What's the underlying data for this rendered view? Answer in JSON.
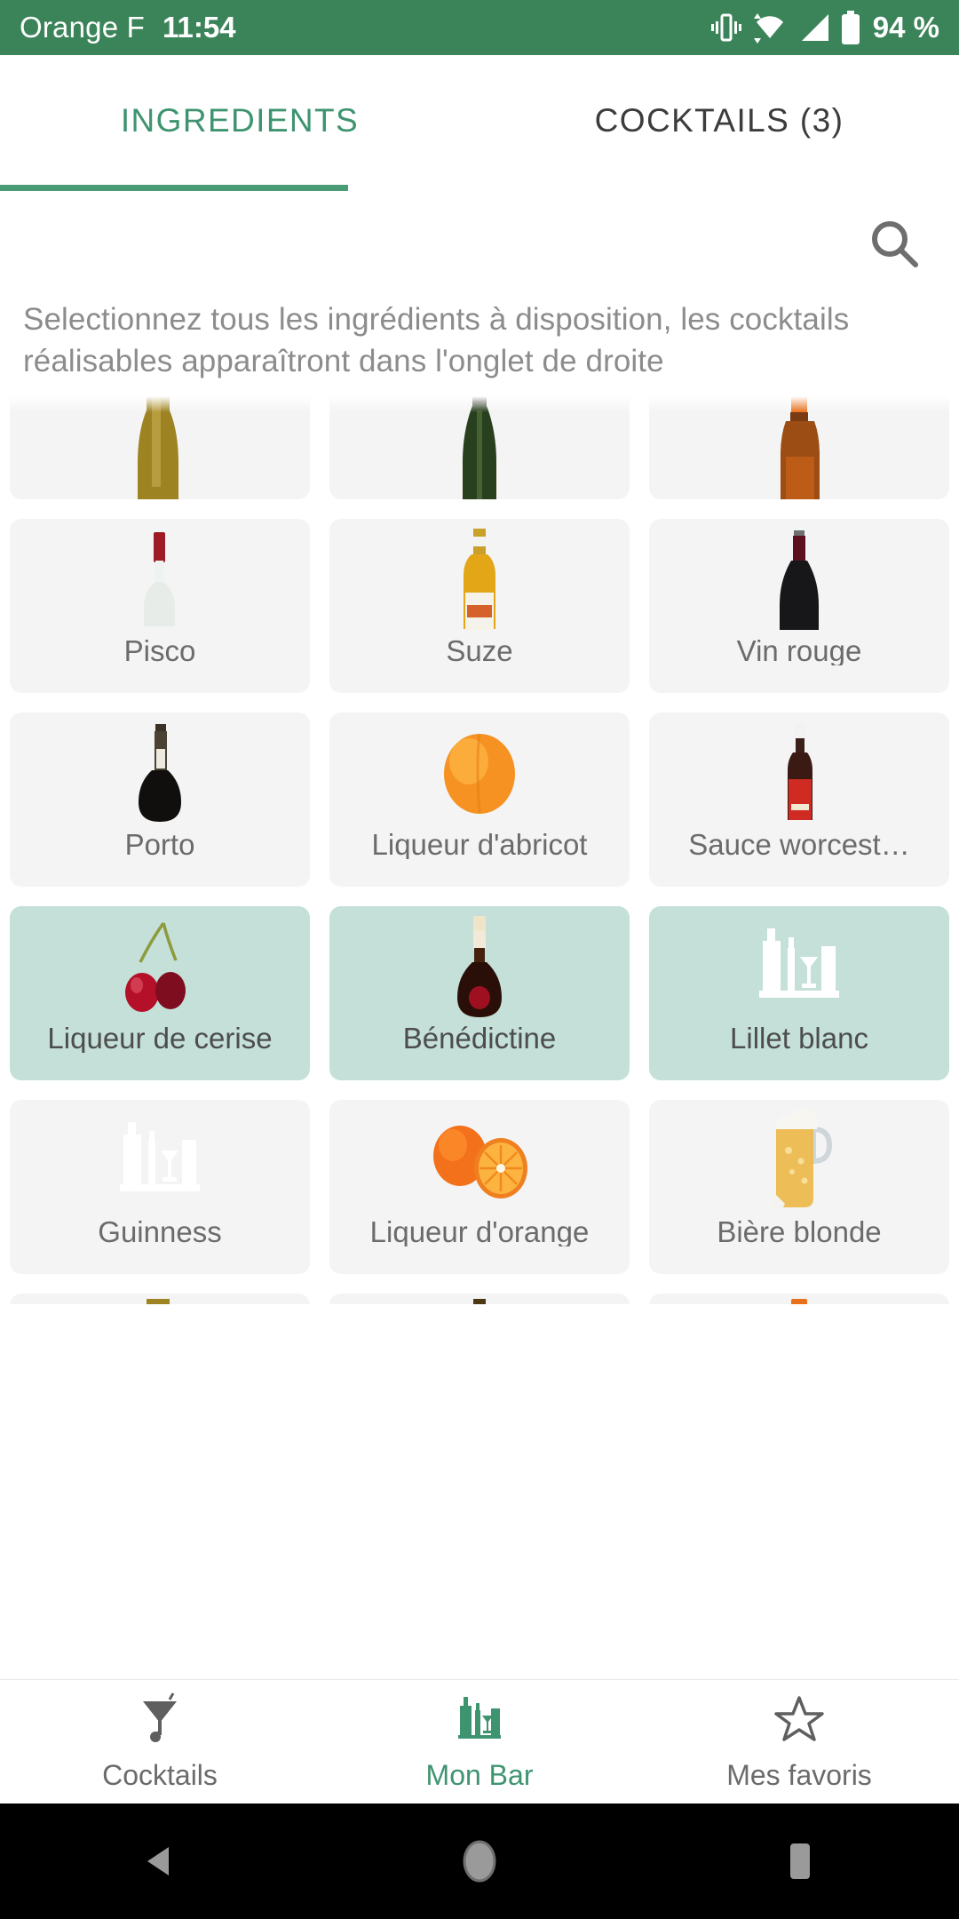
{
  "statusbar": {
    "carrier": "Orange F",
    "time": "11:54",
    "battery": "94 %",
    "icons": [
      "vibrate-icon",
      "wifi-icon",
      "signal-icon",
      "battery-icon"
    ],
    "background_color": "#3b8459"
  },
  "tabs": {
    "ingredients_label": "INGREDIENTS",
    "cocktails_label": "COCKTAILS (3)",
    "active": "INGREDIENTS",
    "accent_color": "#3f9470"
  },
  "search": {
    "icon": "search-icon"
  },
  "description": "Selectionnez tous les ingrédients à disposition, les cocktails réalisables apparaîtront dans l'onglet de droite",
  "grid": {
    "selected_color": "#c4e0d8",
    "card_color": "#f4f4f4",
    "items": [
      {
        "label": "",
        "image": "bottle-gold-partial",
        "selected": false,
        "partial_top": true
      },
      {
        "label": "",
        "image": "bottle-yellow-partial",
        "selected": false,
        "partial_top": true
      },
      {
        "label": "",
        "image": "bottle-red-partial",
        "selected": false,
        "partial_top": true
      },
      {
        "label": "Pisco",
        "image": "pisco-bottle",
        "selected": false
      },
      {
        "label": "Suze",
        "image": "suze-bottle",
        "selected": false
      },
      {
        "label": "Vin rouge",
        "image": "red-wine-bottle",
        "selected": false
      },
      {
        "label": "Porto",
        "image": "porto-bottle",
        "selected": false
      },
      {
        "label": "Liqueur d'abricot",
        "image": "apricot-fruit",
        "selected": false
      },
      {
        "label": "Sauce worcest…",
        "image": "worcestershire-bottle",
        "selected": false
      },
      {
        "label": "Liqueur de cerise",
        "image": "cherries-fruit",
        "selected": true
      },
      {
        "label": "Bénédictine",
        "image": "benedictine-bottle",
        "selected": true
      },
      {
        "label": "Lillet blanc",
        "image": "bar-placeholder-icon",
        "selected": true
      },
      {
        "label": "Guinness",
        "image": "bar-placeholder-icon",
        "selected": false
      },
      {
        "label": "Liqueur d'orange",
        "image": "oranges-fruit",
        "selected": false
      },
      {
        "label": "Bière blonde",
        "image": "beer-mug",
        "selected": false
      },
      {
        "label": "",
        "image": "bottle-olive-partial",
        "selected": false,
        "partial_bottom": true
      },
      {
        "label": "",
        "image": "bottle-green-partial",
        "selected": false,
        "partial_bottom": true
      },
      {
        "label": "",
        "image": "bottle-amber-partial",
        "selected": false,
        "partial_bottom": true
      }
    ]
  },
  "bottomnav": {
    "items": [
      {
        "label": "Cocktails",
        "icon": "cocktail-glass-icon",
        "active": false
      },
      {
        "label": "Mon Bar",
        "icon": "bar-bottles-icon",
        "active": true
      },
      {
        "label": "Mes favoris",
        "icon": "star-icon",
        "active": false
      }
    ]
  },
  "sysnav": {
    "back": "back-triangle-icon",
    "home": "home-circle-icon",
    "recents": "recents-square-icon"
  }
}
